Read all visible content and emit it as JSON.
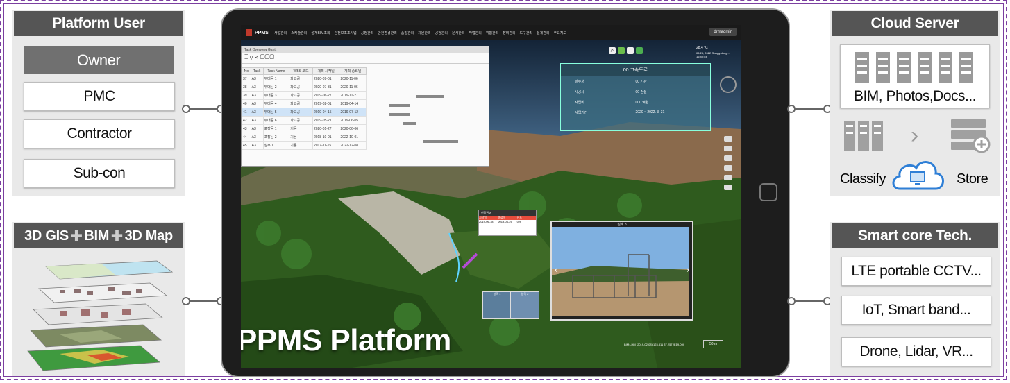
{
  "left_top": {
    "header": "Platform User",
    "items": [
      "Owner",
      "PMC",
      "Contractor",
      "Sub-con"
    ]
  },
  "left_bottom": {
    "header_parts": [
      "3D GIS",
      "BIM",
      "3D Map"
    ],
    "layer_icon": "stacked-map-layers-icon"
  },
  "center": {
    "title": "PPMS Platform",
    "app_name": "PPMS",
    "menu": [
      "사업관리",
      "스케줄관리",
      "설계BIM조회",
      "안전모조조사업",
      "공정관리",
      "안전환경관리",
      "품질관리",
      "자원관리",
      "공정관리",
      "문서관리",
      "작업관리",
      "위험관리",
      "장비관리",
      "도구관리",
      "설계관리",
      "주요지도"
    ],
    "user_button": "drmadmin",
    "window_title": "Task Overview Gantt",
    "table_headers": [
      "No",
      "Task",
      "Task Name",
      "WBS 코드",
      "계획 시작일",
      "계획 종료일"
    ],
    "table_rows": [
      [
        "37",
        "A3",
        "부대공 1",
        "파고공",
        "2020-09-01",
        "2020-11-06"
      ],
      [
        "38",
        "A3",
        "부대공 2",
        "파고공",
        "2020-07-31",
        "2020-11-06"
      ],
      [
        "39",
        "A3",
        "부대공 3",
        "파고공",
        "2019-06-27",
        "2019-11-27"
      ],
      [
        "40",
        "A3",
        "부대공 4",
        "파고공",
        "2019-02-01",
        "2019-04-14"
      ],
      [
        "41",
        "A3",
        "부대공 5",
        "파고공",
        "2019-04-15",
        "2019-07-12"
      ],
      [
        "42",
        "A3",
        "부대공 6",
        "파고공",
        "2019-05-21",
        "2019-06-05"
      ],
      [
        "43",
        "A3",
        "포장공 1",
        "기용",
        "2020-01-27",
        "2020-06-06"
      ],
      [
        "44",
        "A3",
        "포장공 2",
        "기용",
        "2018-10-01",
        "2022-10-01"
      ],
      [
        "45",
        "A3",
        "상부 1",
        "기용",
        "2017-11-15",
        "2022-12-08"
      ]
    ],
    "info_title": "00 고속도로",
    "info_rows": [
      [
        "발주처",
        "00 기관"
      ],
      [
        "시공사",
        "00 건설"
      ],
      [
        "사업비",
        "000 억원"
      ],
      [
        "사업기간",
        "2020 ~ 2022. 3. 31"
      ]
    ],
    "weather": "28.4 °C",
    "location_time": "06.28, 2022 Gangg-dong... 16:40:54",
    "photo_title": "설계 3",
    "popup_title": "현장관 A",
    "popup_headers": [
      "시작일",
      "종료일",
      "진도"
    ],
    "popup_row": [
      "2019-06-18",
      "2019-06-25",
      "0%"
    ],
    "thumb_titles": [
      "항목 1",
      "항목 2"
    ],
    "footer_coords": "BIM:LHM (2019-02-08) 123.311 37.257 (E19-09)",
    "zoom_label": "50 m"
  },
  "right_top": {
    "header": "Cloud Server",
    "storage_label": "BIM, Photos,Docs...",
    "classify_label": "Classify",
    "store_label": "Store",
    "server_icon": "server-rack-icon",
    "cloud_icon": "cloud-computer-icon"
  },
  "right_bottom": {
    "header": "Smart core Tech.",
    "items": [
      "LTE portable CCTV...",
      "IoT, Smart band...",
      "Drone, Lidar, VR..."
    ]
  },
  "colors": {
    "frame": "#7b3fa0",
    "header_bg": "#555555",
    "panel_bg": "#e9e9e9",
    "owner_bg": "#707070",
    "tablet": "#1d1d1d",
    "cloud_blue": "#2f7fd6"
  }
}
